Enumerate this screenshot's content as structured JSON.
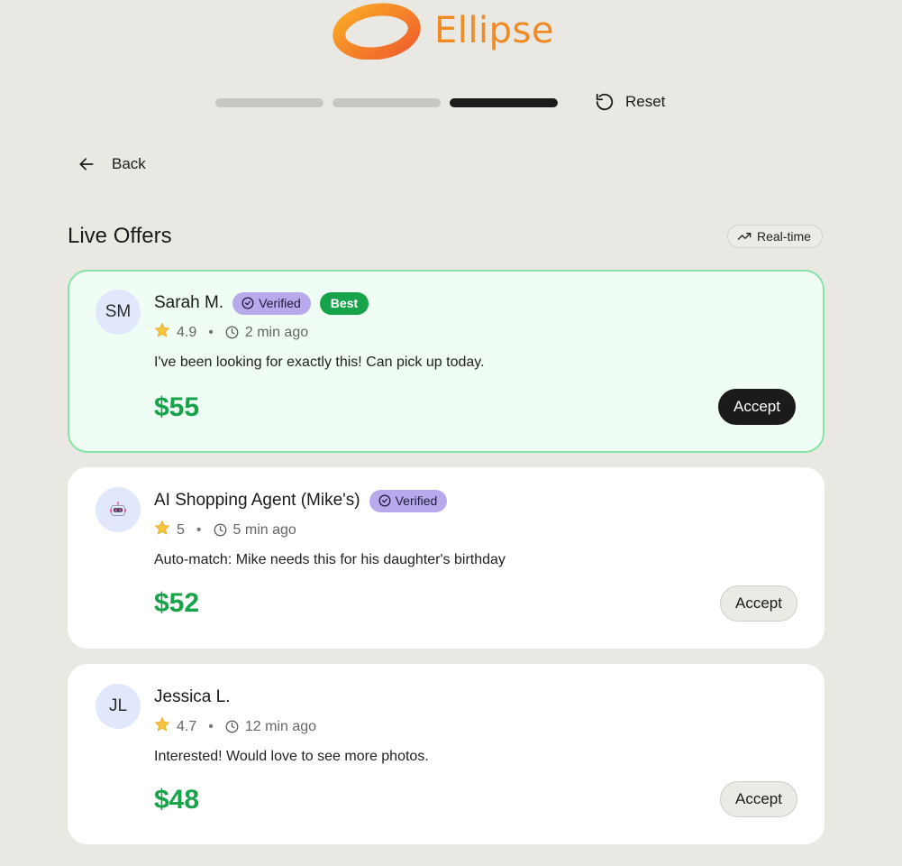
{
  "brand": {
    "name": "Ellipse",
    "colors": {
      "primary": "#f08a24",
      "secondary": "#f26b2c"
    }
  },
  "progress": {
    "steps": 3,
    "current": 3
  },
  "toolbar": {
    "reset_label": "Reset",
    "reset_icon": "rotate-ccw-icon"
  },
  "nav": {
    "back_label": "Back",
    "back_icon": "arrow-left-icon"
  },
  "offers_header": {
    "title": "Live Offers",
    "realtime_label": "Real-time",
    "realtime_icon": "trending-up-icon"
  },
  "offers": [
    {
      "initials": "SM",
      "name": "Sarah M.",
      "verified_label": "Verified",
      "best_label": "Best",
      "rating": "4.9",
      "time": "2 min ago",
      "message": "I've been looking for exactly this! Can pick up today.",
      "price": "$55",
      "accept_label": "Accept"
    },
    {
      "initials": "",
      "avatar_icon": "robot-icon",
      "name": "AI Shopping Agent (Mike's)",
      "verified_label": "Verified",
      "rating": "5",
      "time": "5 min ago",
      "message": "Auto-match: Mike needs this for his daughter's birthday",
      "price": "$52",
      "accept_label": "Accept"
    },
    {
      "initials": "JL",
      "name": "Jessica L.",
      "rating": "4.7",
      "time": "12 min ago",
      "message": "Interested! Would love to see more photos.",
      "price": "$48",
      "accept_label": "Accept"
    }
  ],
  "colors": {
    "background": "#e9e8e3",
    "price": "#16a34a",
    "best_card_bg": "#effdf4",
    "best_card_border": "#86e3a6",
    "verified_badge": "#b8a9ec",
    "best_badge": "#16a34a"
  }
}
